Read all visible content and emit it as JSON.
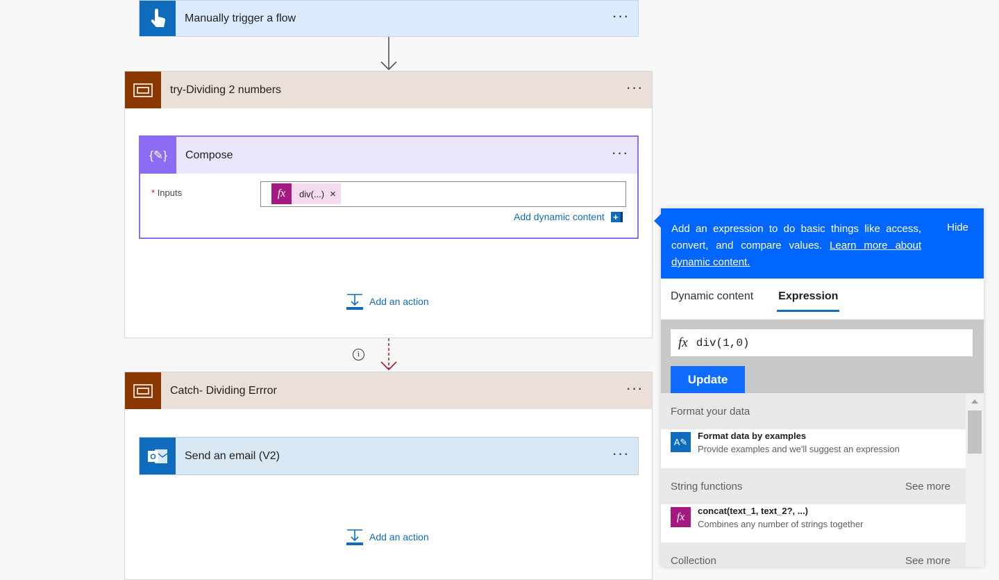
{
  "trigger": {
    "title": "Manually trigger a flow"
  },
  "try_scope": {
    "title": "try-Dividing 2 numbers",
    "add_action": "Add an action"
  },
  "compose": {
    "title": "Compose",
    "inputs_required": "*",
    "inputs_label": "Inputs",
    "token_label": "div(...)",
    "token_remove": "×",
    "add_dynamic": "Add dynamic content"
  },
  "catch_scope": {
    "title": "Catch- Dividing Errror",
    "add_action": "Add an action"
  },
  "email_action": {
    "title": "Send an email (V2)"
  },
  "panel": {
    "banner_text": "Add an expression to do basic things like access, convert, and compare values.",
    "banner_link": "Learn more about dynamic content.",
    "hide": "Hide",
    "tabs": [
      {
        "label": "Dynamic content",
        "active": false
      },
      {
        "label": "Expression",
        "active": true
      }
    ],
    "expression_value": "div(1,0)",
    "update_label": "Update",
    "sections": [
      {
        "title": "Format your data",
        "see_more": ""
      },
      {
        "title": "String functions",
        "see_more": "See more"
      },
      {
        "title": "Collection",
        "see_more": "See more"
      }
    ],
    "items": [
      {
        "title": "Format data by examples",
        "desc": "Provide examples and we'll suggest an expression",
        "icon": "format-data-icon"
      },
      {
        "title": "concat(text_1, text_2?, ...)",
        "desc": "Combines any number of strings together",
        "icon": "fx-icon"
      }
    ]
  },
  "colors": {
    "trigger_header": "#dbeafd",
    "trigger_icon": "#0f6cbd",
    "scope_header": "#ebe0d9",
    "scope_icon": "#8a3800",
    "compose_header": "#ece6fd",
    "compose_icon": "#8c6cf4",
    "panel_banner": "#0066ff",
    "expression_fx": "#a4197f"
  }
}
